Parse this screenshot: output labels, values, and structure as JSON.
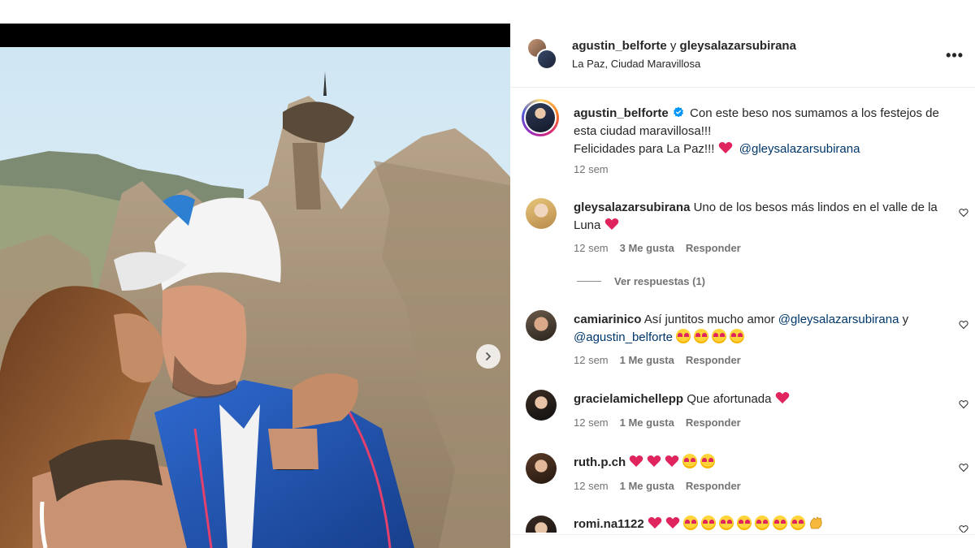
{
  "post": {
    "authors": [
      "agustin_belforte",
      "gleysalazarsubirana"
    ],
    "joiner": "y",
    "location": "La Paz, Ciudad Maravillosa"
  },
  "caption": {
    "user": "agustin_belforte",
    "verified": true,
    "line1": "Con este beso nos sumamos a los festejos de esta ciudad maravillosa!!!",
    "line2": "Felicidades para La Paz!!!",
    "mention": "@gleysalazarsubirana",
    "time": "12 sem"
  },
  "comments": [
    {
      "user": "gleysalazarsubirana",
      "text": "Uno de los besos más lindos en el valle de la Luna",
      "emojis": [
        "heart"
      ],
      "time": "12 sem",
      "likes": "3 Me gusta",
      "reply": "Responder"
    },
    {
      "user": "camiarinico",
      "text": "Así juntitos mucho amor",
      "mentions": [
        "@gleysalazarsubirana",
        "@agustin_belforte"
      ],
      "and": "y",
      "emojis": [
        "heart-eyes",
        "heart-eyes",
        "heart-eyes",
        "heart-eyes"
      ],
      "time": "12 sem",
      "likes": "1 Me gusta",
      "reply": "Responder"
    },
    {
      "user": "gracielamichellepp",
      "text": "Que afortunada",
      "emojis": [
        "heart"
      ],
      "time": "12 sem",
      "likes": "1 Me gusta",
      "reply": "Responder"
    },
    {
      "user": "ruth.p.ch",
      "text": "",
      "emojis": [
        "heart",
        "heart",
        "heart",
        "heart-eyes",
        "heart-eyes"
      ],
      "time": "12 sem",
      "likes": "1 Me gusta",
      "reply": "Responder"
    },
    {
      "user": "romi.na1122",
      "text": "",
      "emojis": [
        "heart",
        "heart",
        "heart-eyes",
        "heart-eyes",
        "heart-eyes",
        "heart-eyes",
        "heart-eyes",
        "heart-eyes",
        "heart-eyes",
        "clap"
      ]
    }
  ],
  "view_replies": "Ver respuestas (1)",
  "colors": {
    "mention": "#00376b",
    "verified": "#0095f6",
    "heart": "#ed4956",
    "meta": "#737373"
  },
  "icons": {
    "more": "more-horizontal-icon",
    "next": "chevron-right-icon",
    "like": "heart-outline-icon"
  }
}
